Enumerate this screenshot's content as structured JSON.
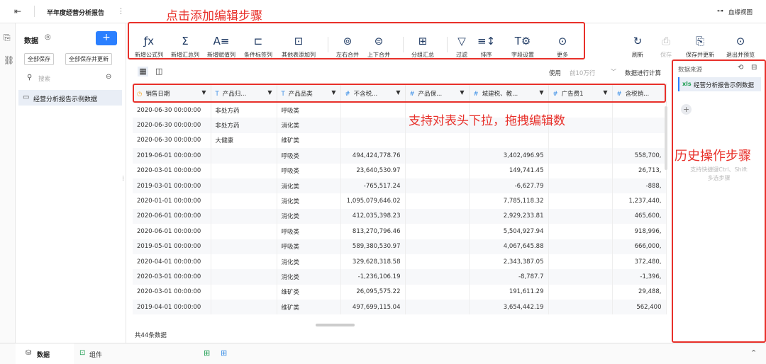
{
  "header": {
    "title": "半年度经营分析报告",
    "lineage": "血缘视图"
  },
  "panel": {
    "title": "数据",
    "save_all": "全部保存",
    "save_update_all": "全部保存并更新",
    "search_placeholder": "搜索",
    "dataset": "经营分析报告示例数据"
  },
  "toolbar": {
    "items": [
      "新增公式列",
      "新增汇总列",
      "新增赋值列",
      "条件标签列",
      "其他表添加列",
      "左右合并",
      "上下合并",
      "分组汇总",
      "过滤",
      "排序",
      "字段设置",
      "更多"
    ],
    "right": [
      "刷新",
      "保存",
      "保存并更新",
      "退出并预览"
    ]
  },
  "view": {
    "use_label": "使用",
    "rows_option": "前10万行",
    "compute_label": "数据进行计算",
    "row_count": "共44条数据"
  },
  "table": {
    "headers": [
      "销售日期",
      "产品归...",
      "产品品类",
      "不含税...",
      "产品保...",
      "城建税、教...",
      "广告费1",
      "含税销..."
    ],
    "rows": [
      [
        "2020-06-30 00:00:00",
        "非处方药",
        "呼吸类",
        "",
        "",
        "",
        "",
        ""
      ],
      [
        "2020-06-30 00:00:00",
        "非处方药",
        "消化类",
        "",
        "",
        "",
        "",
        ""
      ],
      [
        "2020-06-30 00:00:00",
        "大健康",
        "维矿类",
        "",
        "",
        "",
        "",
        ""
      ],
      [
        "2019-06-01 00:00:00",
        "",
        "呼吸类",
        "494,424,778.76",
        "",
        "3,402,496.95",
        "",
        "558,700,"
      ],
      [
        "2020-03-01 00:00:00",
        "",
        "呼吸类",
        "23,640,530.97",
        "",
        "149,741.45",
        "",
        "26,713,"
      ],
      [
        "2019-03-01 00:00:00",
        "",
        "消化类",
        "-765,517.24",
        "",
        "-6,627.79",
        "",
        "-888,"
      ],
      [
        "2020-01-01 00:00:00",
        "",
        "消化类",
        "1,095,079,646.02",
        "",
        "7,785,118.32",
        "",
        "1,237,440,"
      ],
      [
        "2020-06-01 00:00:00",
        "",
        "消化类",
        "412,035,398.23",
        "",
        "2,929,233.81",
        "",
        "465,600,"
      ],
      [
        "2020-06-01 00:00:00",
        "",
        "呼吸类",
        "813,270,796.46",
        "",
        "5,504,927.94",
        "",
        "918,996,"
      ],
      [
        "2019-05-01 00:00:00",
        "",
        "呼吸类",
        "589,380,530.97",
        "",
        "4,067,645.88",
        "",
        "666,000,"
      ],
      [
        "2020-04-01 00:00:00",
        "",
        "消化类",
        "329,628,318.58",
        "",
        "2,343,387.05",
        "",
        "372,480,"
      ],
      [
        "2020-03-01 00:00:00",
        "",
        "消化类",
        "-1,236,106.19",
        "",
        "-8,787.7",
        "",
        "-1,396,"
      ],
      [
        "2020-03-01 00:00:00",
        "",
        "维矿类",
        "26,095,575.22",
        "",
        "191,611.29",
        "",
        "29,488,"
      ],
      [
        "2019-04-01 00:00:00",
        "",
        "维矿类",
        "497,699,115.04",
        "",
        "3,654,442.19",
        "",
        "562,400"
      ]
    ]
  },
  "history": {
    "title": "数据来源",
    "source": "经营分析报告示例数据",
    "hint_line1": "支持快捷键Ctrl、Shift",
    "hint_line2": "多选步骤"
  },
  "annotations": {
    "toolbar": "点击添加编辑步骤",
    "table": "支持对表头下拉，拖拽编辑数",
    "history": "历史操作步骤"
  },
  "bottom": {
    "tab_data": "数据",
    "tab_component": "组件"
  },
  "colors": {
    "accent": "#2a7fff",
    "annotation": "#e8302a",
    "icon": "#1f3a63"
  }
}
